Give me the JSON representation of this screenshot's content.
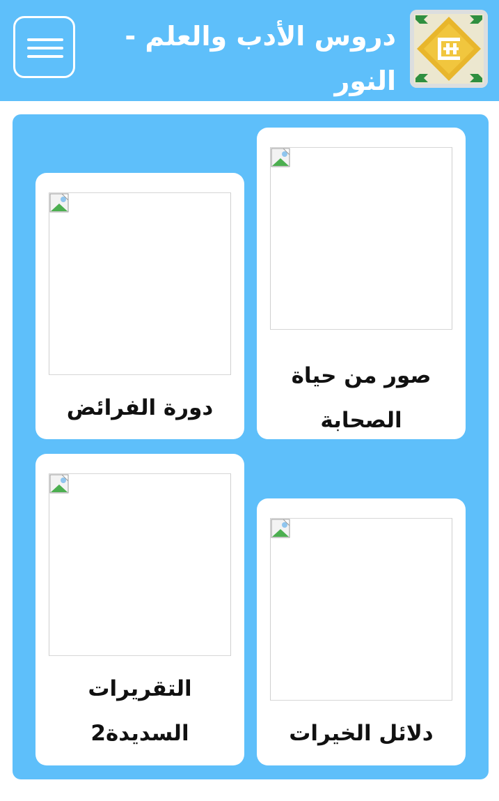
{
  "header": {
    "title": "دروس الأدب والعلم - النور",
    "menu_icon": "hamburger-menu-icon",
    "logo_icon": "square-kufic-logo-icon"
  },
  "colors": {
    "primary": "#5ebffa",
    "card_bg": "#ffffff",
    "text": "#111111",
    "logo_gold": "#e8b62c",
    "logo_green": "#2f8f3f"
  },
  "cards": [
    {
      "title": "صور من حياة الصحابة",
      "image_icon": "broken-image-icon"
    },
    {
      "title": "دورة الفرائض",
      "image_icon": "broken-image-icon"
    },
    {
      "title": "دلائل الخيرات",
      "image_icon": "broken-image-icon"
    },
    {
      "title": "التقريرات السديدة2",
      "image_icon": "broken-image-icon"
    }
  ]
}
